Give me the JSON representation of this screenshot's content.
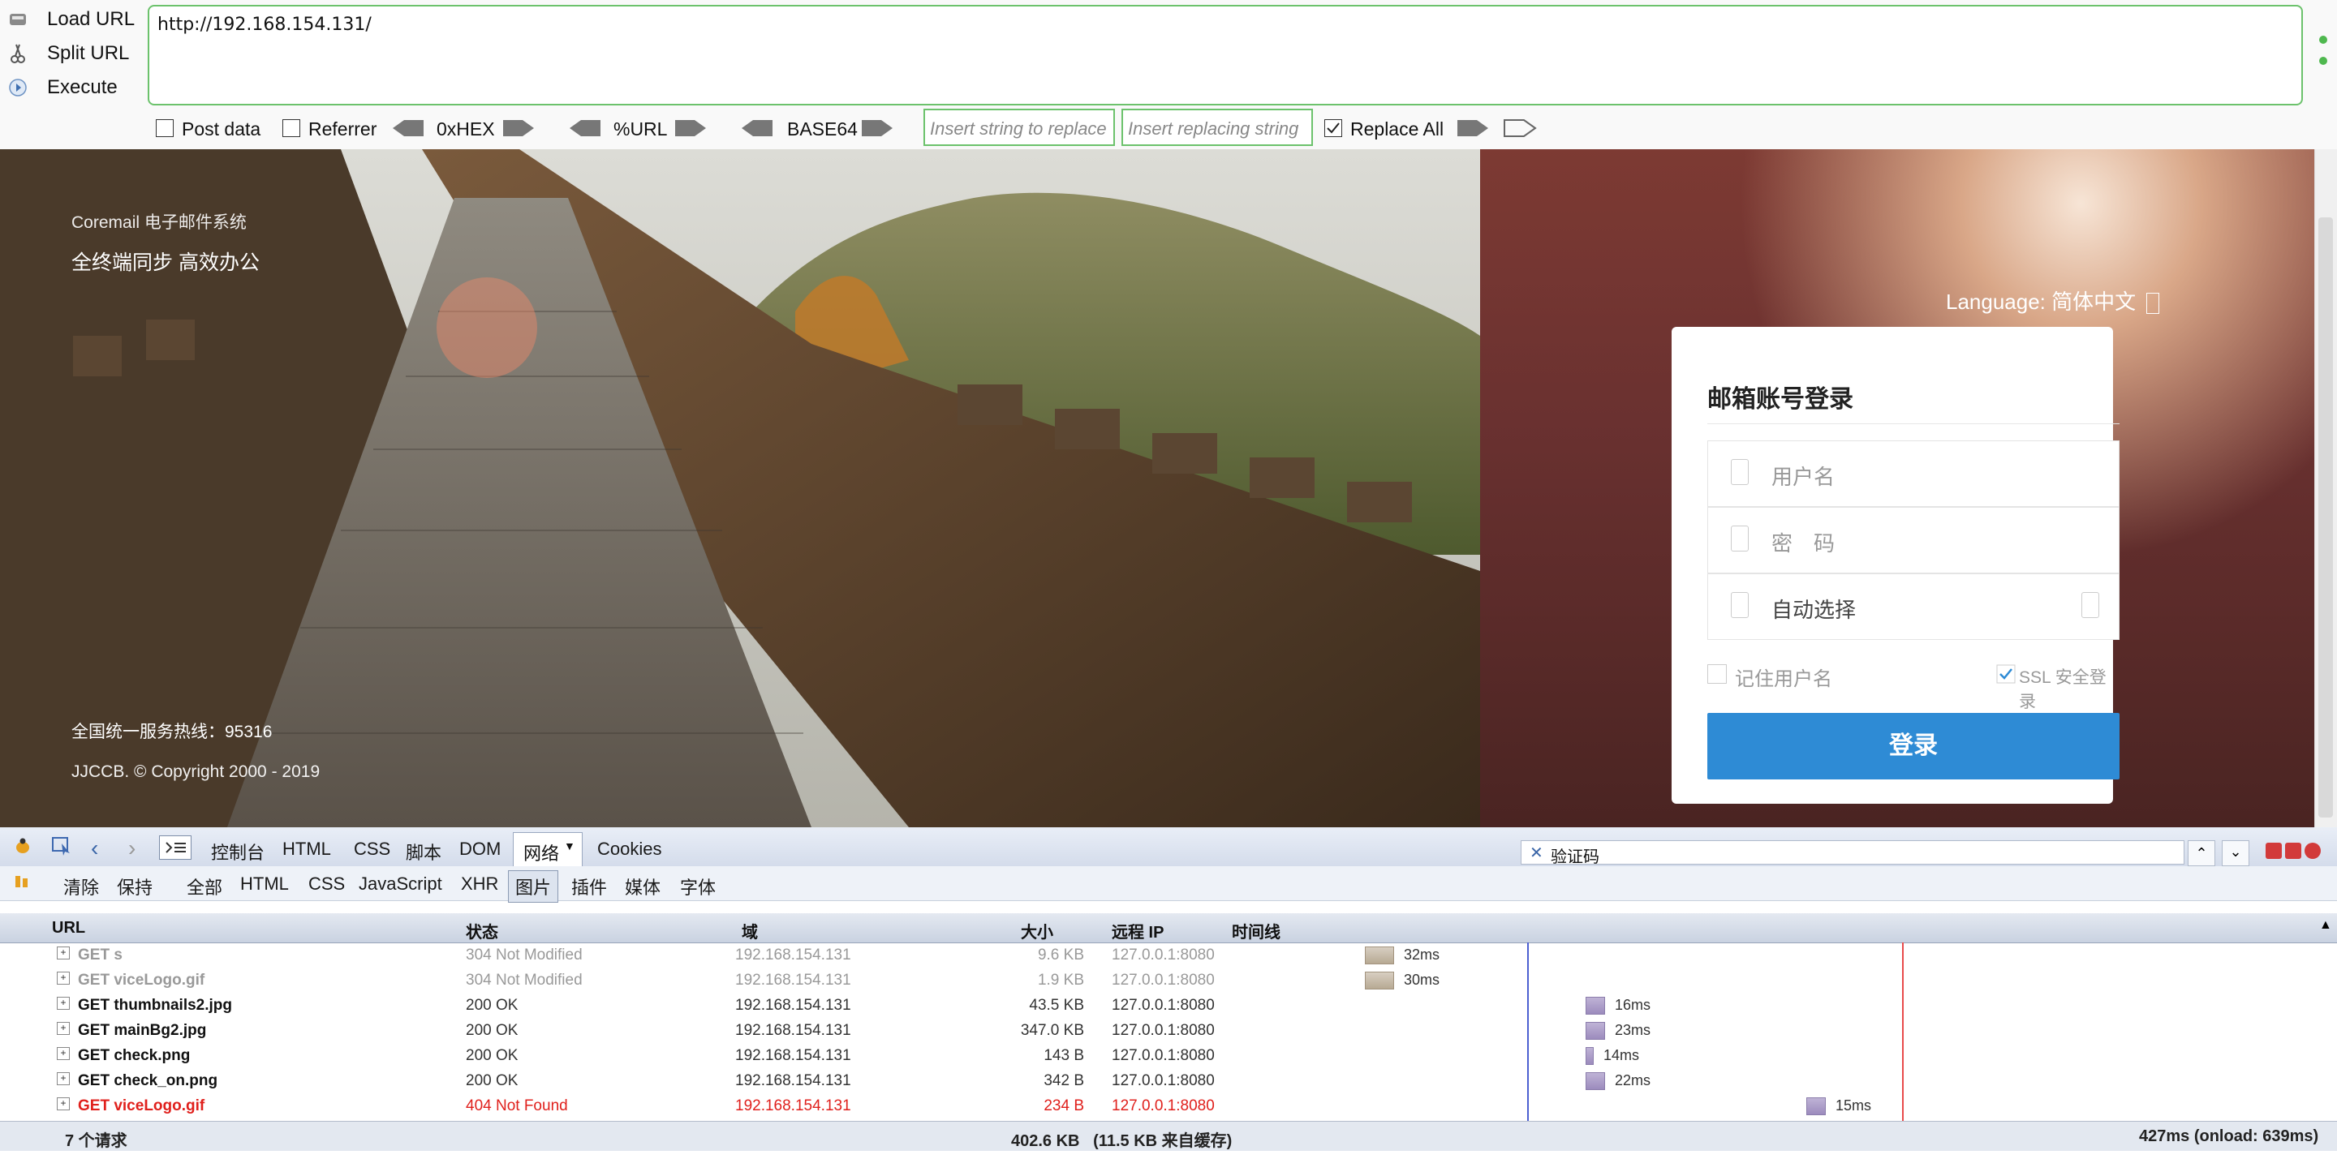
{
  "hackbar": {
    "load_url": "Load URL",
    "split_url": "Split URL",
    "execute": "Execute",
    "url": "http://192.168.154.131/",
    "post_data": "Post data",
    "referrer": "Referrer",
    "hex": "0xHEX",
    "url_enc": "%URL",
    "base64": "BASE64",
    "insert_placeholder": "Insert string to replace",
    "replacing_placeholder": "Insert replacing string",
    "replace_all": "Replace All"
  },
  "page": {
    "brand": "Coremail 电子邮件系统",
    "slogan": "全终端同步 高效办公",
    "hotline": "全国统一服务热线：95316",
    "copyright": "JJCCB. © Copyright 2000 - 2019",
    "language": "Language: 简体中文",
    "login": {
      "title": "邮箱账号登录",
      "username_placeholder": "用户名",
      "password_placeholder": "密　码",
      "domain_select": "自动选择",
      "remember": "记住用户名",
      "ssl": "SSL 安全登录",
      "submit": "登录"
    }
  },
  "firebug": {
    "tabs": [
      "控制台",
      "HTML",
      "CSS",
      "脚本",
      "DOM",
      "网络",
      "Cookies"
    ],
    "active_tab": "网络",
    "search_value": "验证码",
    "subtabs": [
      "清除",
      "保持",
      "全部",
      "HTML",
      "CSS",
      "JavaScript",
      "XHR",
      "图片",
      "插件",
      "媒体",
      "字体"
    ],
    "active_subtab": "图片",
    "columns": [
      "URL",
      "状态",
      "域",
      "大小",
      "远程 IP",
      "时间线"
    ],
    "requests": [
      {
        "url": "GET s",
        "status": "304 Not Modified",
        "domain": "192.168.154.131",
        "size": "9.6 KB",
        "ip": "127.0.0.1:8080",
        "time": "32ms",
        "type": "cached"
      },
      {
        "url": "GET viceLogo.gif",
        "status": "304 Not Modified",
        "domain": "192.168.154.131",
        "size": "1.9 KB",
        "ip": "127.0.0.1:8080",
        "time": "30ms",
        "type": "cached"
      },
      {
        "url": "GET thumbnails2.jpg",
        "status": "200 OK",
        "domain": "192.168.154.131",
        "size": "43.5 KB",
        "ip": "127.0.0.1:8080",
        "time": "16ms",
        "type": "ok"
      },
      {
        "url": "GET mainBg2.jpg",
        "status": "200 OK",
        "domain": "192.168.154.131",
        "size": "347.0 KB",
        "ip": "127.0.0.1:8080",
        "time": "23ms",
        "type": "ok"
      },
      {
        "url": "GET check.png",
        "status": "200 OK",
        "domain": "192.168.154.131",
        "size": "143 B",
        "ip": "127.0.0.1:8080",
        "time": "14ms",
        "type": "ok"
      },
      {
        "url": "GET check_on.png",
        "status": "200 OK",
        "domain": "192.168.154.131",
        "size": "342 B",
        "ip": "127.0.0.1:8080",
        "time": "22ms",
        "type": "ok"
      },
      {
        "url": "GET viceLogo.gif",
        "status": "404 Not Found",
        "domain": "192.168.154.131",
        "size": "234 B",
        "ip": "127.0.0.1:8080",
        "time": "15ms",
        "type": "error"
      }
    ],
    "footer": {
      "count": "7 个请求",
      "total": "402.6 KB   (11.5 KB 来自缓存)",
      "timing": "427ms (onload: 639ms)"
    }
  },
  "colors": {
    "accent_green": "#6cc26c",
    "login_blue": "#2e8bd5",
    "error_red": "#e0201c"
  }
}
